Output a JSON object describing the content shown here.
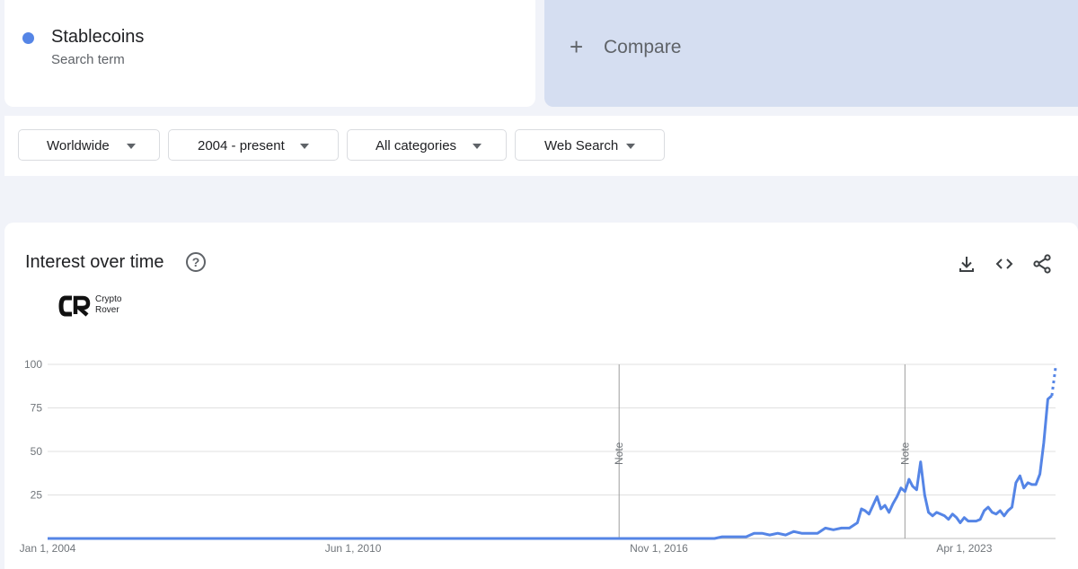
{
  "search_term": {
    "name": "Stablecoins",
    "subtitle": "Search term",
    "color": "#5585e6"
  },
  "compare": {
    "plus": "+",
    "label": "Compare"
  },
  "filters": [
    {
      "label": "Worldwide"
    },
    {
      "label": "2004 - present"
    },
    {
      "label": "All categories"
    },
    {
      "label": "Web Search"
    }
  ],
  "chart_header": {
    "title": "Interest over time",
    "help": "?",
    "icons": [
      "download-icon",
      "embed-icon",
      "share-icon"
    ]
  },
  "watermark": {
    "line1": "Crypto",
    "line2": "Rover"
  },
  "chart_data": {
    "type": "line",
    "title": "Interest over time",
    "xlabel": "",
    "ylabel": "",
    "ylim": [
      0,
      100
    ],
    "y_ticks": [
      25,
      50,
      75,
      100
    ],
    "x_ticks": [
      {
        "label": "Jan 1, 2004",
        "date": "2004-01-01"
      },
      {
        "label": "Jun 1, 2010",
        "date": "2010-06-01"
      },
      {
        "label": "Nov 1, 2016",
        "date": "2016-11-01"
      },
      {
        "label": "Apr 1, 2023",
        "date": "2023-04-01"
      }
    ],
    "xlim": [
      "2004-01-01",
      "2025-03-01"
    ],
    "grid": true,
    "line_color": "#5585e6",
    "annotations": [
      {
        "label": "Note",
        "date": "2016-01-01"
      },
      {
        "label": "Note",
        "date": "2022-01-01"
      }
    ],
    "series": [
      {
        "name": "Stablecoins",
        "partial_from": "2025-02-01",
        "points": [
          [
            "2004-01-01",
            0
          ],
          [
            "2017-01-01",
            0
          ],
          [
            "2018-01-01",
            0
          ],
          [
            "2018-03-01",
            1
          ],
          [
            "2018-06-01",
            1
          ],
          [
            "2018-09-01",
            1
          ],
          [
            "2018-11-01",
            3
          ],
          [
            "2019-01-01",
            3
          ],
          [
            "2019-03-01",
            2
          ],
          [
            "2019-05-01",
            3
          ],
          [
            "2019-07-01",
            2
          ],
          [
            "2019-09-01",
            4
          ],
          [
            "2019-11-01",
            3
          ],
          [
            "2020-01-01",
            3
          ],
          [
            "2020-03-01",
            3
          ],
          [
            "2020-05-01",
            6
          ],
          [
            "2020-07-01",
            5
          ],
          [
            "2020-09-01",
            6
          ],
          [
            "2020-11-01",
            6
          ],
          [
            "2021-01-01",
            9
          ],
          [
            "2021-02-01",
            17
          ],
          [
            "2021-03-01",
            16
          ],
          [
            "2021-04-01",
            14
          ],
          [
            "2021-05-01",
            19
          ],
          [
            "2021-06-01",
            24
          ],
          [
            "2021-07-01",
            17
          ],
          [
            "2021-08-01",
            19
          ],
          [
            "2021-09-01",
            15
          ],
          [
            "2021-10-01",
            20
          ],
          [
            "2021-11-01",
            24
          ],
          [
            "2021-12-01",
            29
          ],
          [
            "2022-01-01",
            27
          ],
          [
            "2022-02-01",
            34
          ],
          [
            "2022-03-01",
            30
          ],
          [
            "2022-04-01",
            28
          ],
          [
            "2022-05-01",
            44
          ],
          [
            "2022-06-01",
            25
          ],
          [
            "2022-07-01",
            15
          ],
          [
            "2022-08-01",
            13
          ],
          [
            "2022-09-01",
            15
          ],
          [
            "2022-10-01",
            14
          ],
          [
            "2022-11-01",
            13
          ],
          [
            "2022-12-01",
            11
          ],
          [
            "2023-01-01",
            14
          ],
          [
            "2023-02-01",
            12
          ],
          [
            "2023-03-01",
            9
          ],
          [
            "2023-04-01",
            12
          ],
          [
            "2023-05-01",
            10
          ],
          [
            "2023-06-01",
            10
          ],
          [
            "2023-07-01",
            10
          ],
          [
            "2023-08-01",
            11
          ],
          [
            "2023-09-01",
            16
          ],
          [
            "2023-10-01",
            18
          ],
          [
            "2023-11-01",
            15
          ],
          [
            "2023-12-01",
            14
          ],
          [
            "2024-01-01",
            16
          ],
          [
            "2024-02-01",
            13
          ],
          [
            "2024-03-01",
            16
          ],
          [
            "2024-04-01",
            18
          ],
          [
            "2024-05-01",
            32
          ],
          [
            "2024-06-01",
            36
          ],
          [
            "2024-07-01",
            29
          ],
          [
            "2024-08-01",
            32
          ],
          [
            "2024-09-01",
            31
          ],
          [
            "2024-10-01",
            31
          ],
          [
            "2024-11-01",
            37
          ],
          [
            "2024-12-01",
            55
          ],
          [
            "2025-01-01",
            80
          ],
          [
            "2025-02-01",
            82
          ],
          [
            "2025-03-01",
            98
          ]
        ]
      }
    ]
  }
}
